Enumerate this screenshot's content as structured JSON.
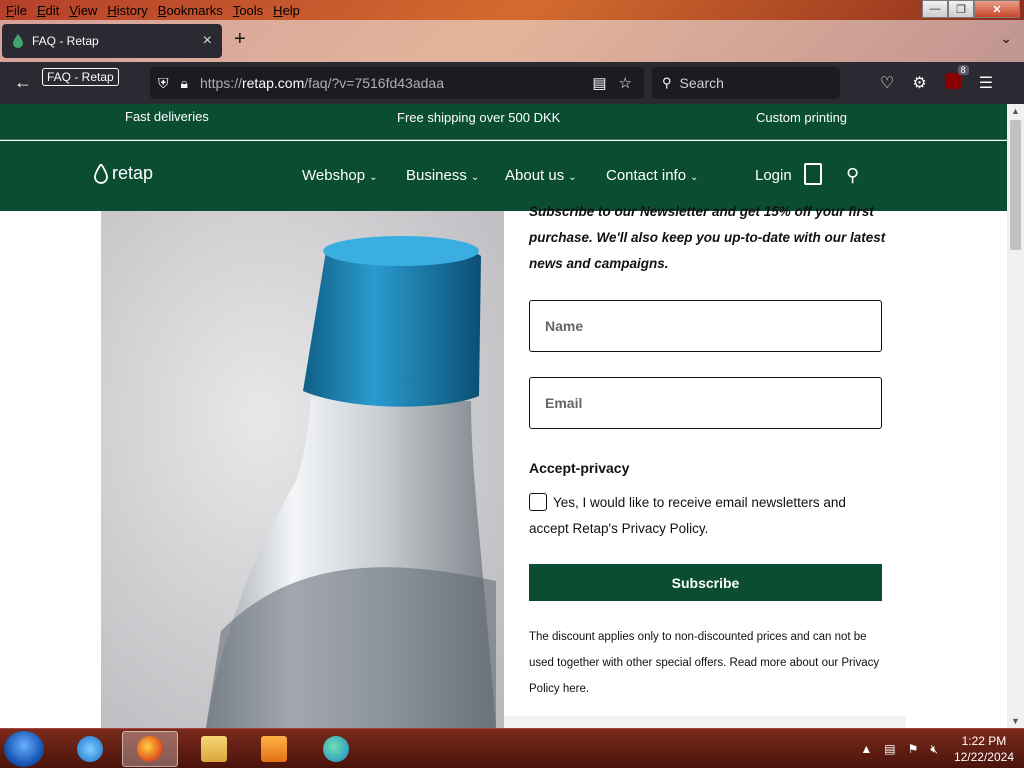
{
  "menubar": {
    "items": [
      {
        "label": "File",
        "u": "F",
        "rest": "ile"
      },
      {
        "label": "Edit",
        "u": "E",
        "rest": "dit"
      },
      {
        "label": "View",
        "u": "V",
        "rest": "iew"
      },
      {
        "label": "History",
        "u": "H",
        "rest": "istory"
      },
      {
        "label": "Bookmarks",
        "u": "B",
        "rest": "ookmarks"
      },
      {
        "label": "Tools",
        "u": "T",
        "rest": "ools"
      },
      {
        "label": "Help",
        "u": "H",
        "rest": "elp"
      }
    ]
  },
  "browser": {
    "tab_title": "FAQ - Retap",
    "tooltip": "FAQ - Retap",
    "url_prefix": "https://",
    "url_domain": "retap.com",
    "url_path": "/faq/?v=7516fd43adaa",
    "search_placeholder": "Search",
    "extension_badge": "8"
  },
  "site": {
    "strip": {
      "fast": "Fast deliveries",
      "shipping": "Free shipping over 500 DKK",
      "printing": "Custom printing"
    },
    "logo_text": "retap",
    "nav": {
      "webshop": "Webshop",
      "business": "Business",
      "about": "About us",
      "contact": "Contact info",
      "login": "Login"
    }
  },
  "newsletter": {
    "intro": "Subscribe to our Newsletter and get 15% off your first purchase. We'll also keep you up-to-date with our latest news and campaigns.",
    "name_placeholder": "Name",
    "email_placeholder": "Email",
    "privacy_heading": "Accept-privacy",
    "consent": "Yes, I would like to receive email newsletters and accept Retap's Privacy Policy.",
    "subscribe": "Subscribe",
    "disclaimer": "The discount applies only to non-discounted prices and can not be used together with other special offers. Read more about our Privacy Policy here."
  },
  "taskbar": {
    "time": "1:22 PM",
    "date": "12/22/2024"
  },
  "colors": {
    "brand_green": "#0a4d33",
    "browser_dark": "#2b2a33"
  }
}
